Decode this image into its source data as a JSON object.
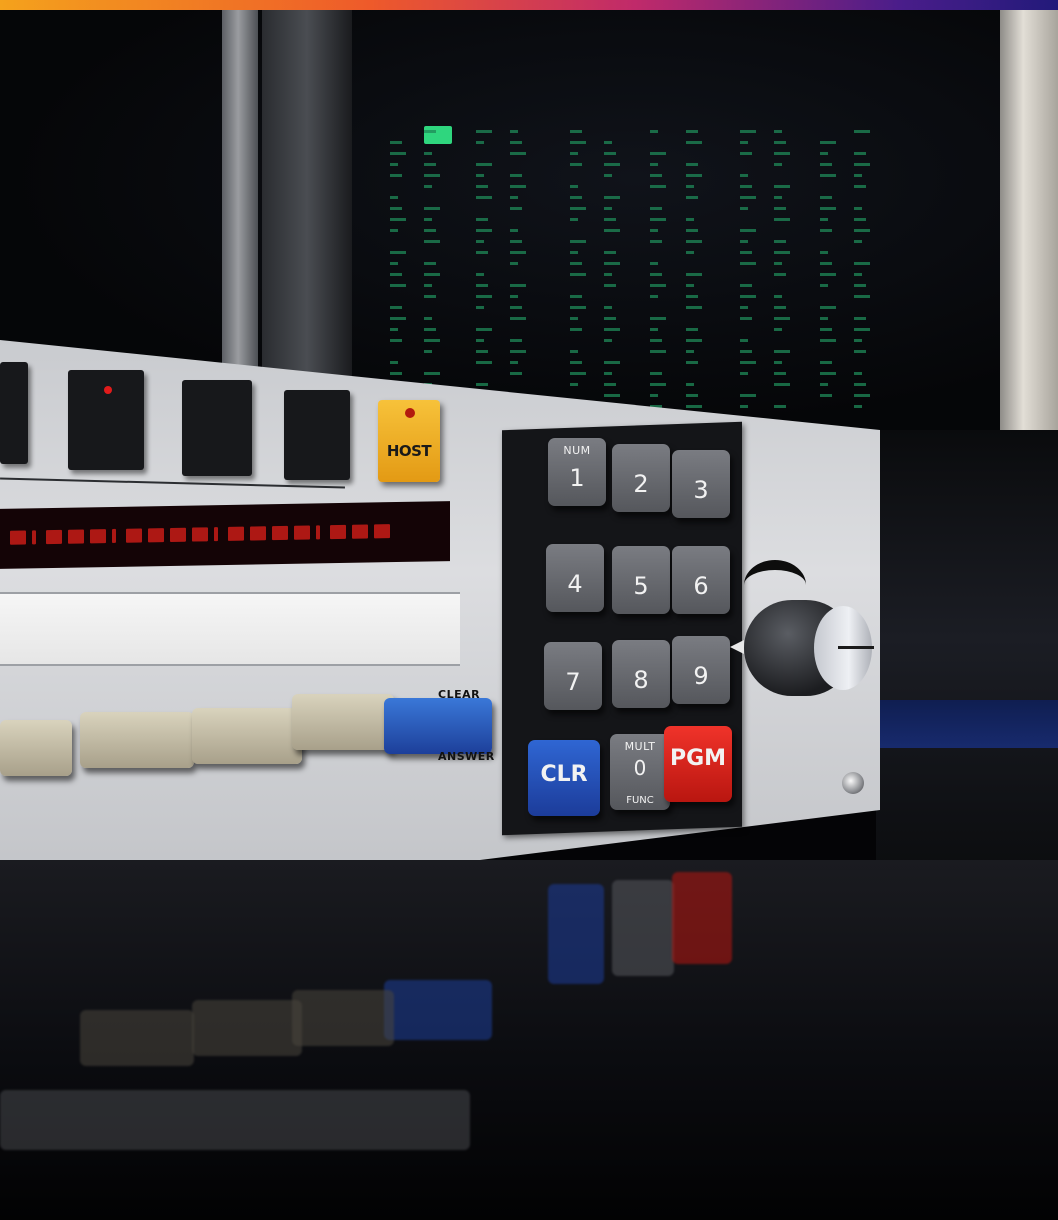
{
  "panel": {
    "host_key_label": "HOST",
    "switch_labels": {
      "clear": "CLEAR",
      "answer": "ANSWER"
    }
  },
  "keypad": {
    "keys": [
      {
        "top": "NUM",
        "main": "1",
        "bottom": ""
      },
      {
        "top": "",
        "main": "2",
        "bottom": ""
      },
      {
        "top": "",
        "main": "3",
        "bottom": ""
      },
      {
        "top": "",
        "main": "4",
        "bottom": ""
      },
      {
        "top": "",
        "main": "5",
        "bottom": ""
      },
      {
        "top": "",
        "main": "6",
        "bottom": ""
      },
      {
        "top": "",
        "main": "7",
        "bottom": ""
      },
      {
        "top": "",
        "main": "8",
        "bottom": ""
      },
      {
        "top": "",
        "main": "9",
        "bottom": ""
      },
      {
        "top": "",
        "main": "CLR",
        "bottom": ""
      },
      {
        "top": "MULT",
        "main": "0",
        "bottom": "FUNC"
      },
      {
        "top": "",
        "main": "PGM",
        "bottom": ""
      }
    ]
  },
  "colors": {
    "host_key": "#f2b22a",
    "clr_key": "#2452c4",
    "pgm_key": "#e0241c",
    "display_led": "#d8211d",
    "screen_text": "#1f8a58"
  },
  "icons": [
    "indicator-led",
    "rotary-knob",
    "knob-pointer-arrow",
    "panel-screw"
  ]
}
